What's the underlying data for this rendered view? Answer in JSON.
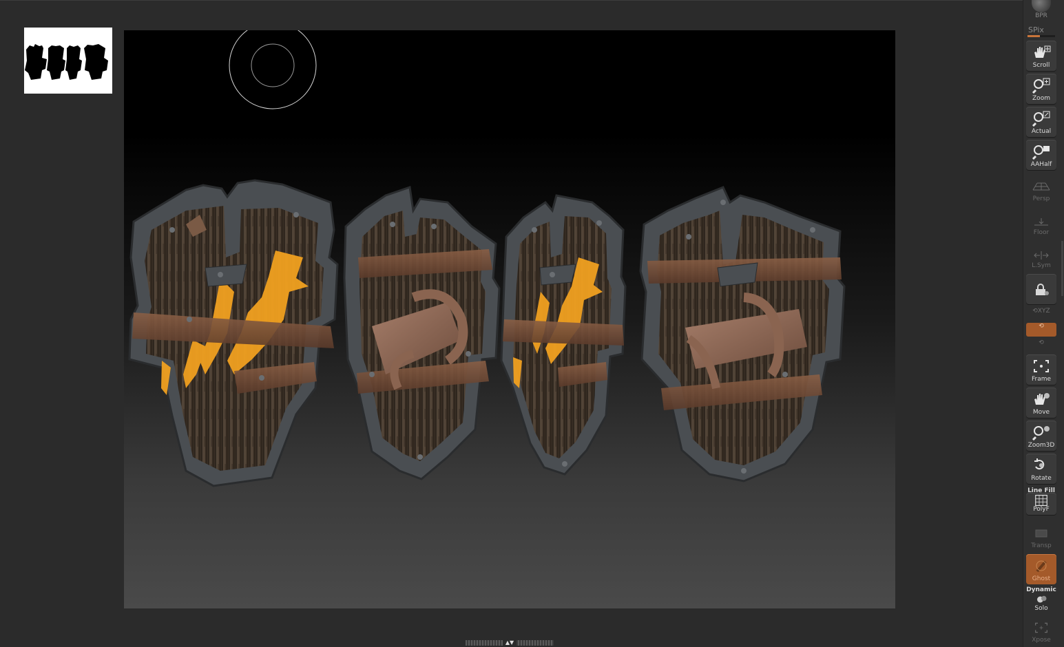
{
  "render_top": {
    "bpr_label": "BPR",
    "spix_label": "SPix",
    "spix_value": 0.45
  },
  "navigator": {
    "thumbnail_icon": "shield-silhouettes-icon"
  },
  "canvas": {
    "background_top": "#000000",
    "background_bottom": "#4a4a4a",
    "subjects": [
      "shield-front-painted",
      "shield-back-strapped",
      "shield-front-painted-small",
      "shield-back-strapped-wide"
    ],
    "paint_color": "#f0a020",
    "wood_color": "#4a3a2c",
    "metal_color": "#4a4e52"
  },
  "shelf": {
    "scroll": "Scroll",
    "zoom": "Zoom",
    "actual": "Actual",
    "aahalf": "AAHalf",
    "persp": "Persp",
    "floor": "Floor",
    "lsym": "L.Sym",
    "lock_icon": "lock-camera-icon",
    "xyz": "XYZ",
    "frame": "Frame",
    "move": "Move",
    "zoom3d": "Zoom3D",
    "rotate": "Rotate",
    "line_fill": "Line Fill",
    "polyf": "PolyF",
    "transp": "Transp",
    "ghost": "Ghost",
    "dynamic": "Dynamic",
    "solo": "Solo",
    "xpose": "Xpose"
  },
  "colors": {
    "accent": "#a45a2a",
    "panel": "#2f2f2f",
    "button": "#3a3a3a"
  }
}
